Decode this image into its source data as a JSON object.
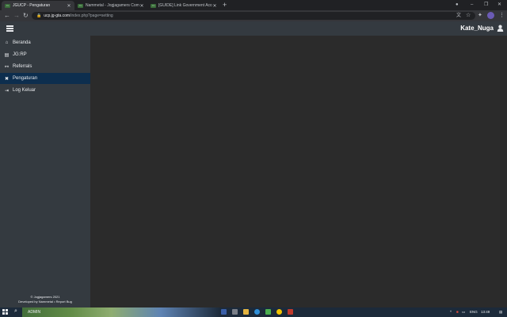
{
  "browser": {
    "tabs": [
      {
        "favicon": "JG",
        "title": "JGUCP - Pengaturan",
        "active": true
      },
      {
        "favicon": "JG",
        "title": "Nammetal - Jogjagamers Commu...",
        "active": false
      },
      {
        "favicon": "JG",
        "title": "[GUIDE] Link Government Accou...",
        "active": false
      }
    ],
    "new_tab": "+",
    "url_host": "ucp.jg-gta.com",
    "url_path": "/index.php?page=setting",
    "window_controls": [
      "–",
      "❐",
      "✕"
    ],
    "nav": {
      "back": "←",
      "forward": "→",
      "reload": "↻"
    }
  },
  "header": {
    "username": "Kate_Nuga",
    "icons": [
      "hamburger-menu-icon",
      "user-icon"
    ]
  },
  "sidebar": {
    "items": [
      {
        "label": "Beranda",
        "icon": "home-icon",
        "glyph": "⌂",
        "active": false
      },
      {
        "label": "JG:RP",
        "icon": "server-icon",
        "glyph": "▤",
        "active": false
      },
      {
        "label": "Referrals",
        "icon": "handshake-icon",
        "glyph": "⚯",
        "active": false
      },
      {
        "label": "Pengaturan",
        "icon": "tools-icon",
        "glyph": "✖",
        "active": true
      },
      {
        "label": "Log Keluar",
        "icon": "sign-out-icon",
        "glyph": "⇥",
        "active": false
      }
    ],
    "footer_copyright": "© Jogjagamers 2021",
    "footer_credit": "Developed by Nammetal • Report Bug"
  },
  "taskbar": {
    "user_label": "ADMIN",
    "language": "ENG",
    "time": "13:49"
  },
  "colors": {
    "sidebar_bg": "#343a40",
    "active_item": "#0d2e4e",
    "content_bg": "#2b2b2b"
  }
}
